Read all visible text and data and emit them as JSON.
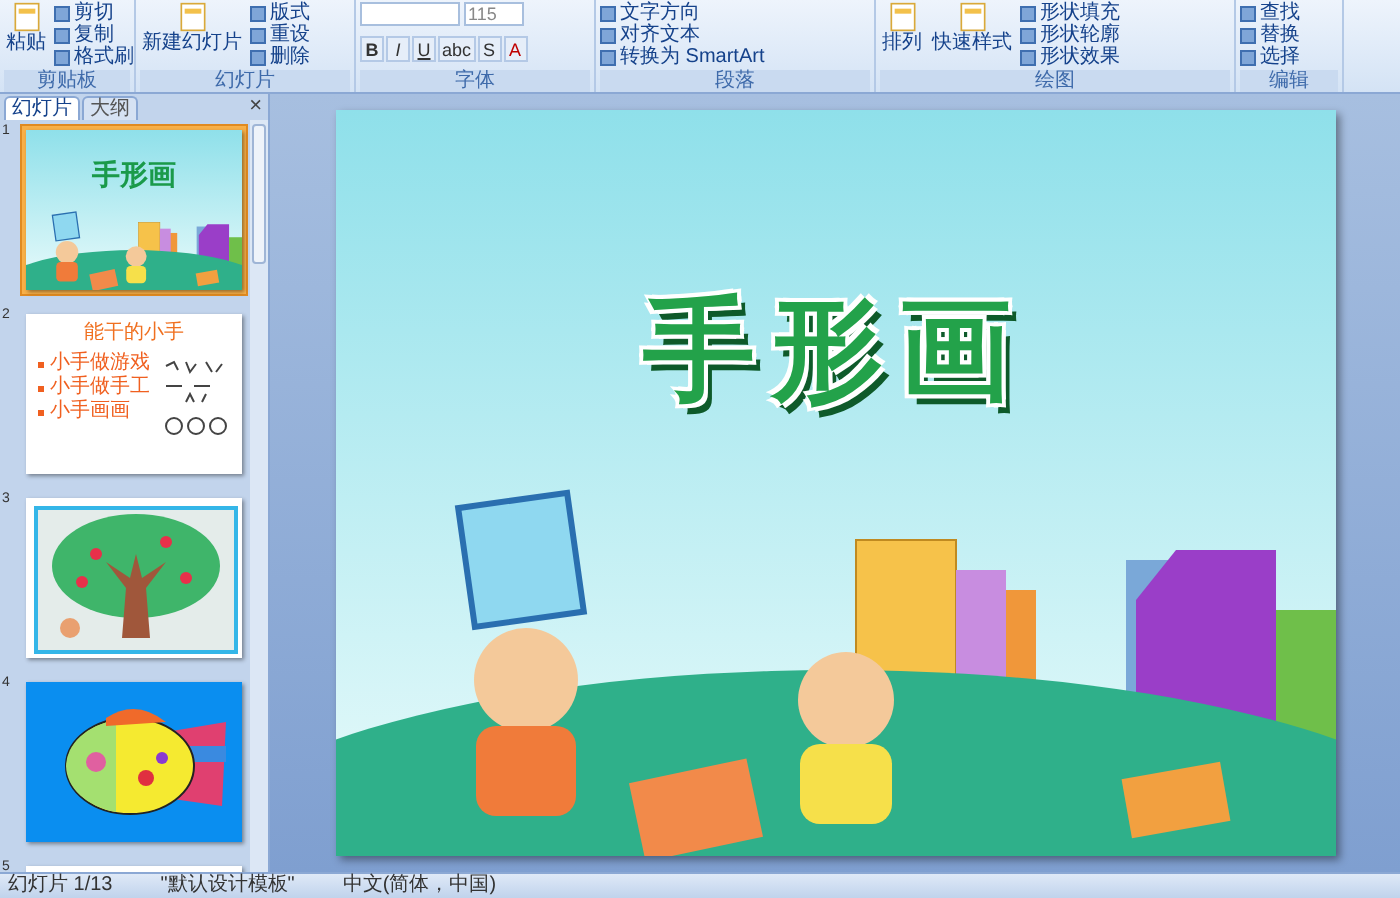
{
  "ribbon": {
    "groups": [
      {
        "label": "剪贴板",
        "large": [
          "粘贴"
        ],
        "small": [
          "剪切",
          "复制",
          "格式刷"
        ]
      },
      {
        "label": "幻灯片",
        "large": [
          "新建幻灯片"
        ],
        "small": [
          "版式",
          "重设",
          "删除"
        ]
      },
      {
        "label": "字体",
        "field": "115",
        "format_buttons": [
          "B",
          "I",
          "U",
          "abc",
          "S",
          "A"
        ]
      },
      {
        "label": "段落",
        "small": [
          "文字方向",
          "对齐文本",
          "转换为 SmartArt"
        ]
      },
      {
        "label": "绘图",
        "large": [
          "排列",
          "快速样式"
        ],
        "small": [
          "形状填充",
          "形状轮廓",
          "形状效果"
        ]
      },
      {
        "label": "编辑",
        "small": [
          "查找",
          "替换",
          "选择"
        ]
      }
    ]
  },
  "pane": {
    "tabs": [
      {
        "label": "幻灯片",
        "selected": true
      },
      {
        "label": "大纲",
        "selected": false
      }
    ],
    "close": "×"
  },
  "slides": [
    {
      "number": "1",
      "selected": true,
      "kind": "title",
      "title": "手形画"
    },
    {
      "number": "2",
      "selected": false,
      "kind": "list",
      "title": "能干的小手",
      "bullets": [
        "小手做游戏",
        "小手做手工",
        "小手画画"
      ]
    },
    {
      "number": "3",
      "selected": false,
      "kind": "tree"
    },
    {
      "number": "4",
      "selected": false,
      "kind": "fish"
    },
    {
      "number": "5",
      "selected": false,
      "kind": "blank"
    }
  ],
  "current_slide": {
    "title": "手形画"
  },
  "status_bar": [
    "幻灯片 1/13",
    "\"默认设计模板\"",
    "中文(简体，中国)"
  ]
}
